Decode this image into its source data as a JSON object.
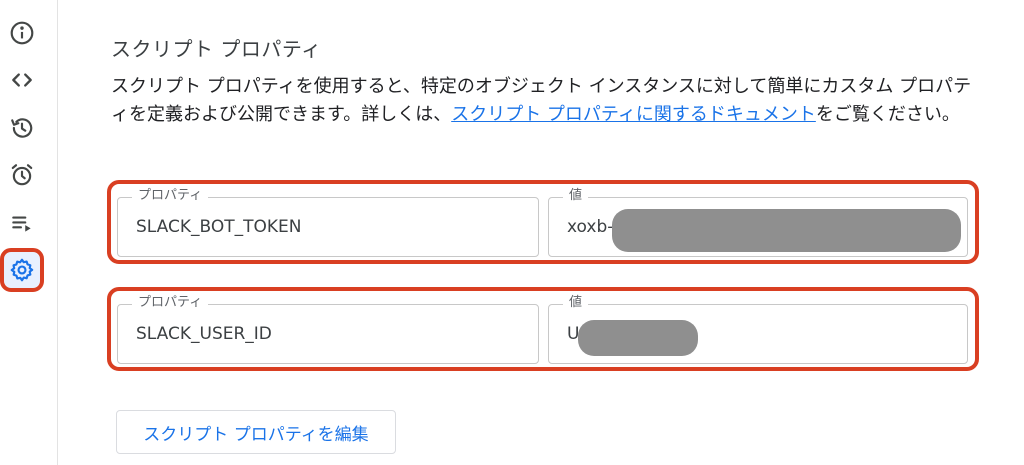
{
  "sidebar": {
    "items": [
      {
        "name": "info-icon"
      },
      {
        "name": "code-icon"
      },
      {
        "name": "history-icon"
      },
      {
        "name": "alarm-clock-icon"
      },
      {
        "name": "playlist-play-icon"
      },
      {
        "name": "gear-icon",
        "active": true
      }
    ]
  },
  "section": {
    "title": "スクリプト プロパティ",
    "description_before": "スクリプト プロパティを使用すると、特定のオブジェクト インスタンスに対して簡単にカスタム プロパティを定義および公開できます。詳しくは、",
    "description_link": "スクリプト プロパティに関するドキュメント",
    "description_after": "をご覧ください。"
  },
  "properties": [
    {
      "property_label": "プロパティ",
      "property_value": "SLACK_BOT_TOKEN",
      "value_label": "値",
      "value_visible": "xoxb-"
    },
    {
      "property_label": "プロパティ",
      "property_value": "SLACK_USER_ID",
      "value_label": "値",
      "value_visible": "U"
    }
  ],
  "edit_button_label": "スクリプト プロパティを編集",
  "colors": {
    "accent": "#1a73e8",
    "highlight": "#d93f22",
    "redaction": "#8f8f8f"
  }
}
